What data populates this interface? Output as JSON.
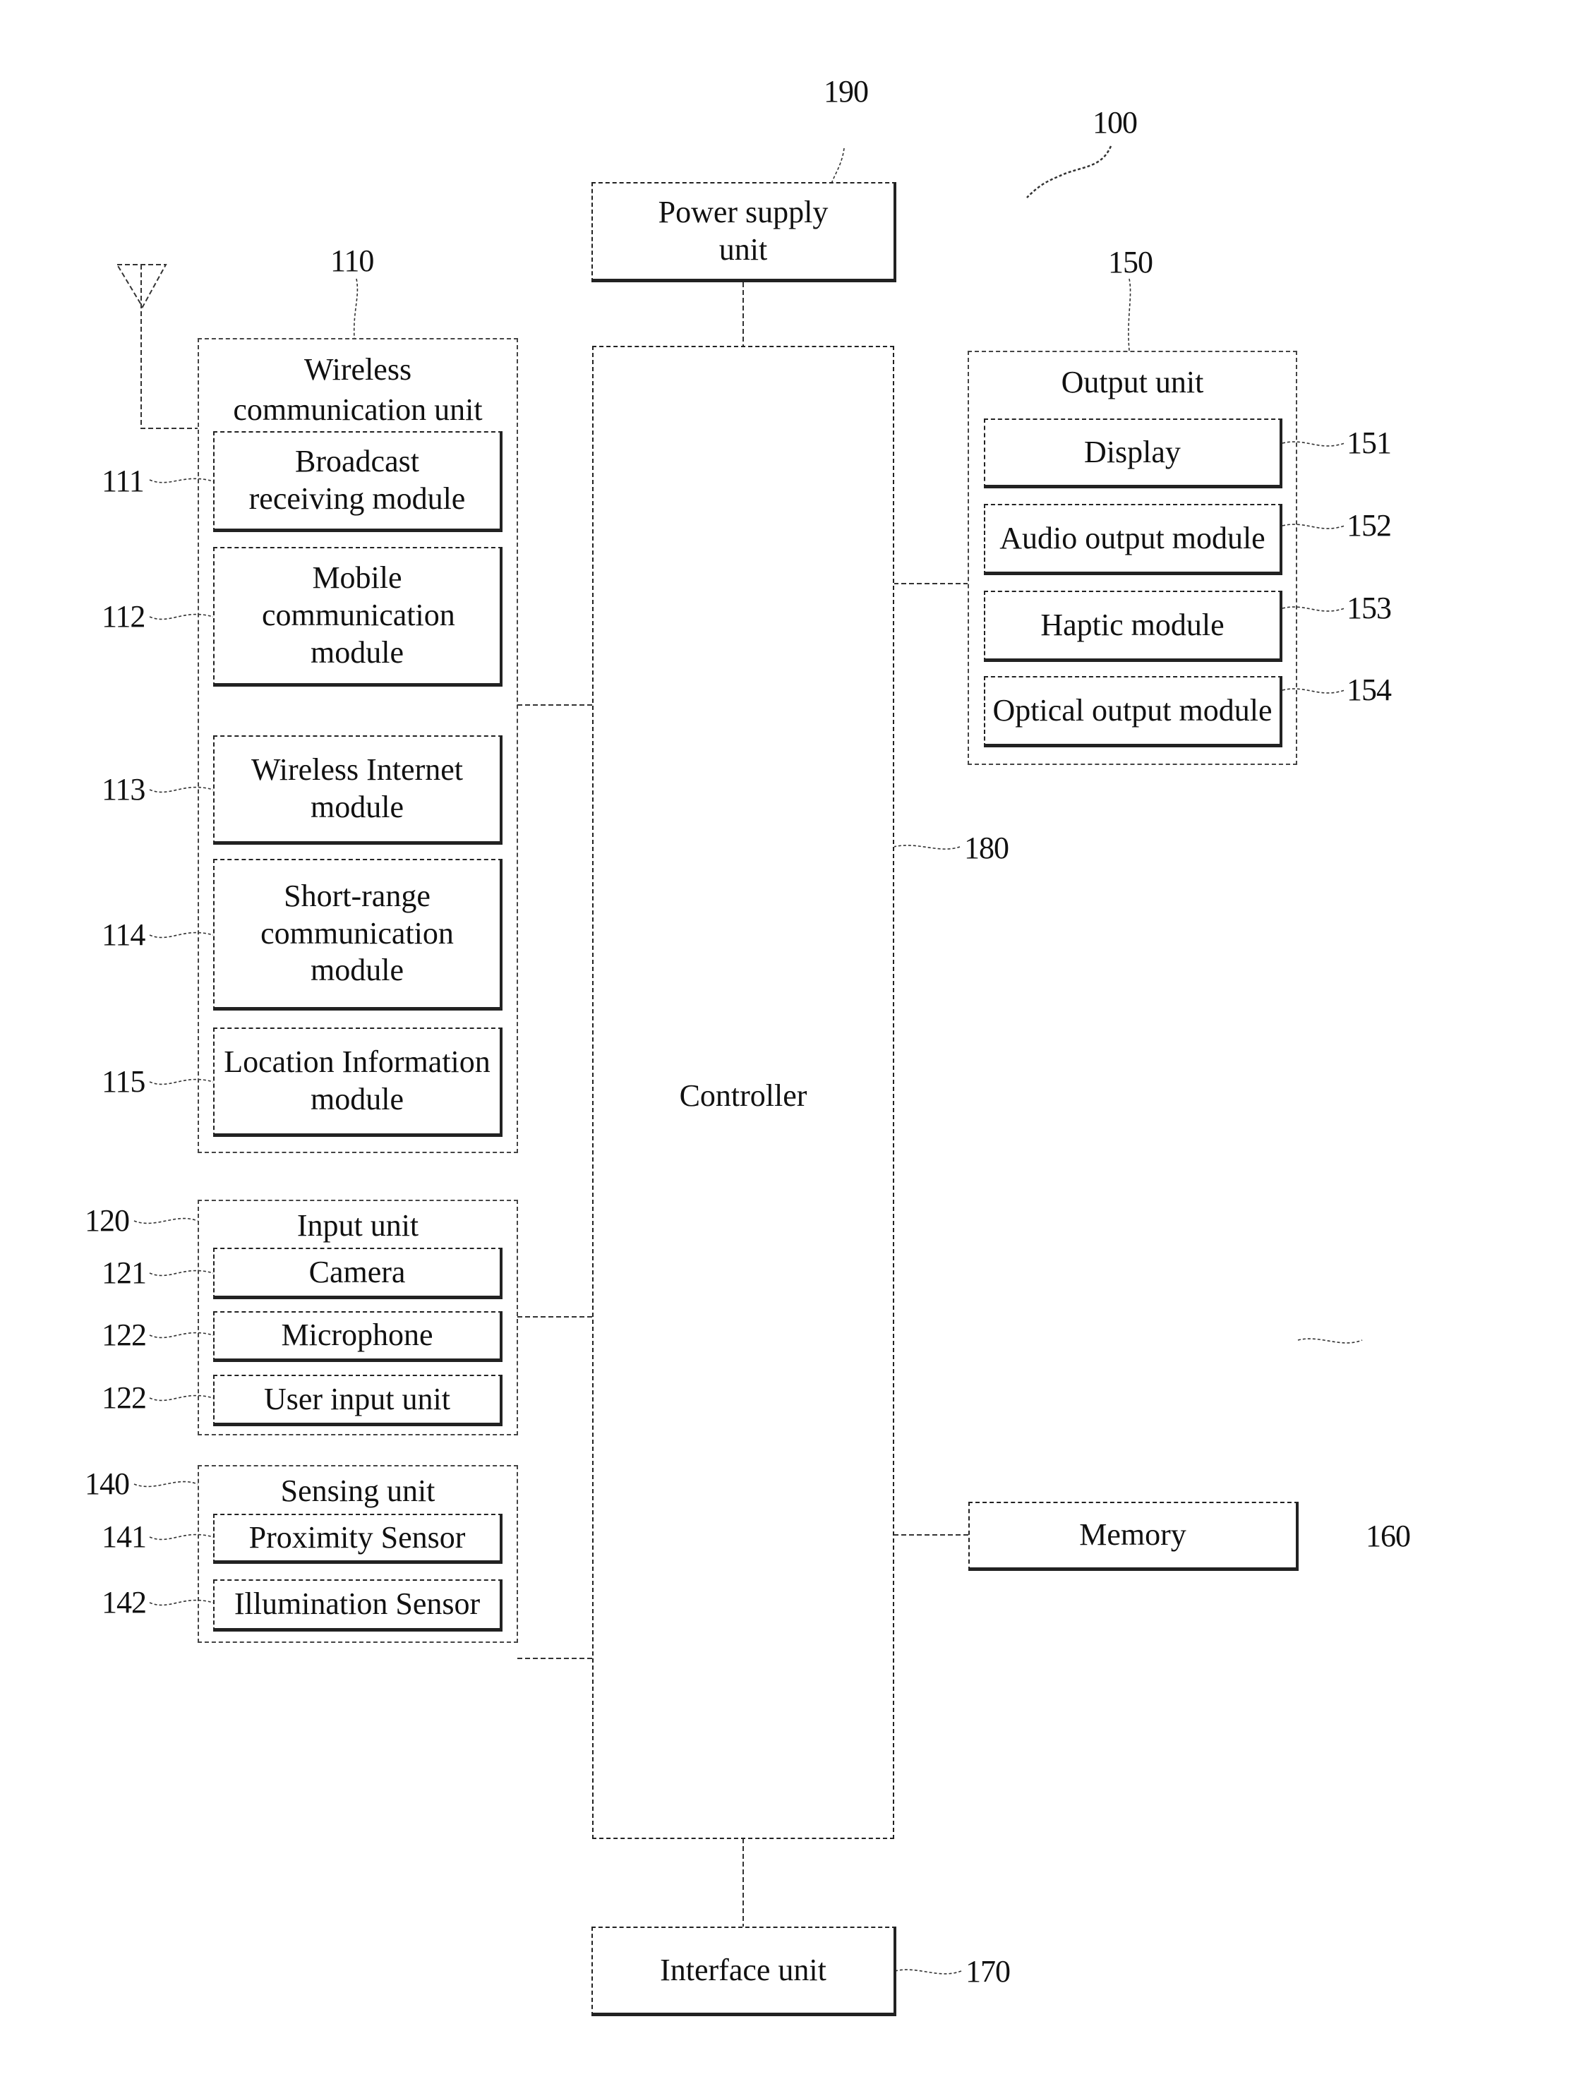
{
  "figure": {
    "device_ref": "100",
    "power_supply": {
      "label": "Power supply unit",
      "ref": "190"
    },
    "controller": {
      "label": "Controller",
      "ref": "180"
    },
    "interface": {
      "label": "Interface unit",
      "ref": "170"
    },
    "memory": {
      "label": "Memory",
      "ref": "160"
    },
    "wireless": {
      "title": "Wireless communication unit",
      "ref": "110",
      "modules": [
        {
          "label": "Broadcast receiving module",
          "ref": "111"
        },
        {
          "label": "Mobile communication module",
          "ref": "112"
        },
        {
          "label": "Wireless Internet module",
          "ref": "113"
        },
        {
          "label": "Short-range communication module",
          "ref": "114"
        },
        {
          "label": "Location Information module",
          "ref": "115"
        }
      ]
    },
    "input": {
      "title": "Input unit",
      "ref": "120",
      "modules": [
        {
          "label": "Camera",
          "ref": "121"
        },
        {
          "label": "Microphone",
          "ref": "122"
        },
        {
          "label": "User input unit",
          "ref": "122"
        }
      ]
    },
    "sensing": {
      "title": "Sensing unit",
      "ref": "140",
      "modules": [
        {
          "label": "Proximity Sensor",
          "ref": "141"
        },
        {
          "label": "Illumination Sensor",
          "ref": "142"
        }
      ]
    },
    "output": {
      "title": "Output unit",
      "ref": "150",
      "modules": [
        {
          "label": "Display",
          "ref": "151"
        },
        {
          "label": "Audio output module",
          "ref": "152"
        },
        {
          "label": "Haptic module",
          "ref": "153"
        },
        {
          "label": "Optical output module",
          "ref": "154"
        }
      ]
    }
  }
}
